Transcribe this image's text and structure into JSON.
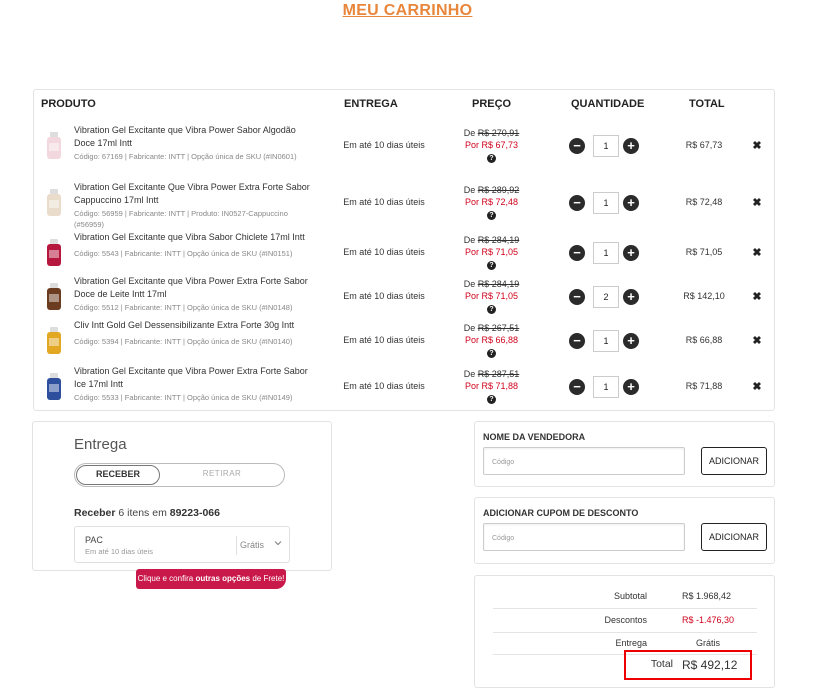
{
  "page_title": "MEU CARRINHO",
  "cart": {
    "headers": {
      "product": "PRODUTO",
      "delivery": "ENTREGA",
      "price": "PREÇO",
      "quantity": "QUANTIDADE",
      "total": "TOTAL"
    },
    "items": [
      {
        "name": "Vibration Gel Excitante que Vibra Power Sabor Algodão Doce 17ml Intt",
        "meta": "Código: 67169 | Fabricante: INTT | Opção única de SKU (#IN0601)",
        "delivery": "Em até 10 dias úteis",
        "price_from_label": "De",
        "price_old": "R$ 270,91",
        "price_new": "Por R$ 67,73",
        "qty": "1",
        "total": "R$ 67,73",
        "thumb_color": "#f3d7df"
      },
      {
        "name": "Vibration Gel Excitante Que Vibra Power Extra Forte Sabor Cappuccino 17ml Intt",
        "meta": "Código: 56959 | Fabricante: INTT | Produto: IN0527-Cappuccino (#56959)",
        "delivery": "Em até 10 dias úteis",
        "price_from_label": "De",
        "price_old": "R$ 289,92",
        "price_new": "Por R$ 72,48",
        "qty": "1",
        "total": "R$ 72,48",
        "thumb_color": "#e9dccb"
      },
      {
        "name": "Vibration Gel Excitante que Vibra Sabor Chiclete 17ml Intt",
        "meta": "Código: 5543 | Fabricante: INTT | Opção única de SKU (#IN0151)",
        "delivery": "Em até 10 dias úteis",
        "price_from_label": "De",
        "price_old": "R$ 284,19",
        "price_new": "Por R$ 71,05",
        "qty": "1",
        "total": "R$ 71,05",
        "thumb_color": "#b5173f"
      },
      {
        "name": "Vibration Gel Excitante que Vibra Power Extra Forte Sabor Doce de Leite Intt 17ml",
        "meta": "Código: 5512 | Fabricante: INTT | Opção única de SKU (#IN0148)",
        "delivery": "Em até 10 dias úteis",
        "price_from_label": "De",
        "price_old": "R$ 284,19",
        "price_new": "Por R$ 71,05",
        "qty": "2",
        "total": "R$ 142,10",
        "thumb_color": "#6b3c1f"
      },
      {
        "name": "Cliv Intt Gold Gel Dessensibilizante Extra Forte 30g Intt",
        "meta": "Código: 5394 | Fabricante: INTT | Opção única de SKU (#IN0140)",
        "delivery": "Em até 10 dias úteis",
        "price_from_label": "De",
        "price_old": "R$ 267,51",
        "price_new": "Por R$ 66,88",
        "qty": "1",
        "total": "R$ 66,88",
        "thumb_color": "#e2a823"
      },
      {
        "name": "Vibration Gel Excitante que Vibra Power Extra Forte Sabor Ice 17ml Intt",
        "meta": "Código: 5533 | Fabricante: INTT | Opção única de SKU (#IN0149)",
        "delivery": "Em até 10 dias úteis",
        "price_from_label": "De",
        "price_old": "R$ 287,51",
        "price_new": "Por R$ 71,88",
        "qty": "1",
        "total": "R$ 71,88",
        "thumb_color": "#2e4f9e"
      }
    ],
    "minus_symbol": "−",
    "plus_symbol": "+",
    "remove_symbol": "✖",
    "help_symbol": "?"
  },
  "shipping": {
    "title": "Entrega",
    "toggle_on": "RECEBER",
    "toggle_off": "RETIRAR",
    "receive_prefix": "Receber",
    "items_text": "6 itens em",
    "zip": "89223-066",
    "option_name": "PAC",
    "option_eta": "Em até 10 dias úteis",
    "option_price": "Grátis",
    "promo_prefix": "Clique e confira",
    "promo_bold": "outras opções",
    "promo_suffix": "de Frete!"
  },
  "seller": {
    "label": "NOME DA VENDEDORA",
    "placeholder": "Código",
    "button": "ADICIONAR"
  },
  "coupon": {
    "label": "ADICIONAR CUPOM DE DESCONTO",
    "placeholder": "Código",
    "button": "ADICIONAR"
  },
  "summary": {
    "subtotal_label": "Subtotal",
    "subtotal": "R$ 1.968,42",
    "discount_label": "Descontos",
    "discount": "R$ -1.476,30",
    "delivery_label": "Entrega",
    "delivery": "Grátis",
    "total_label": "Total",
    "total": "R$ 492,12"
  },
  "colors": {
    "accent": "#e8863c",
    "price_red": "#d0021b",
    "promo": "#c9194a",
    "highlight": "#ee0000"
  }
}
